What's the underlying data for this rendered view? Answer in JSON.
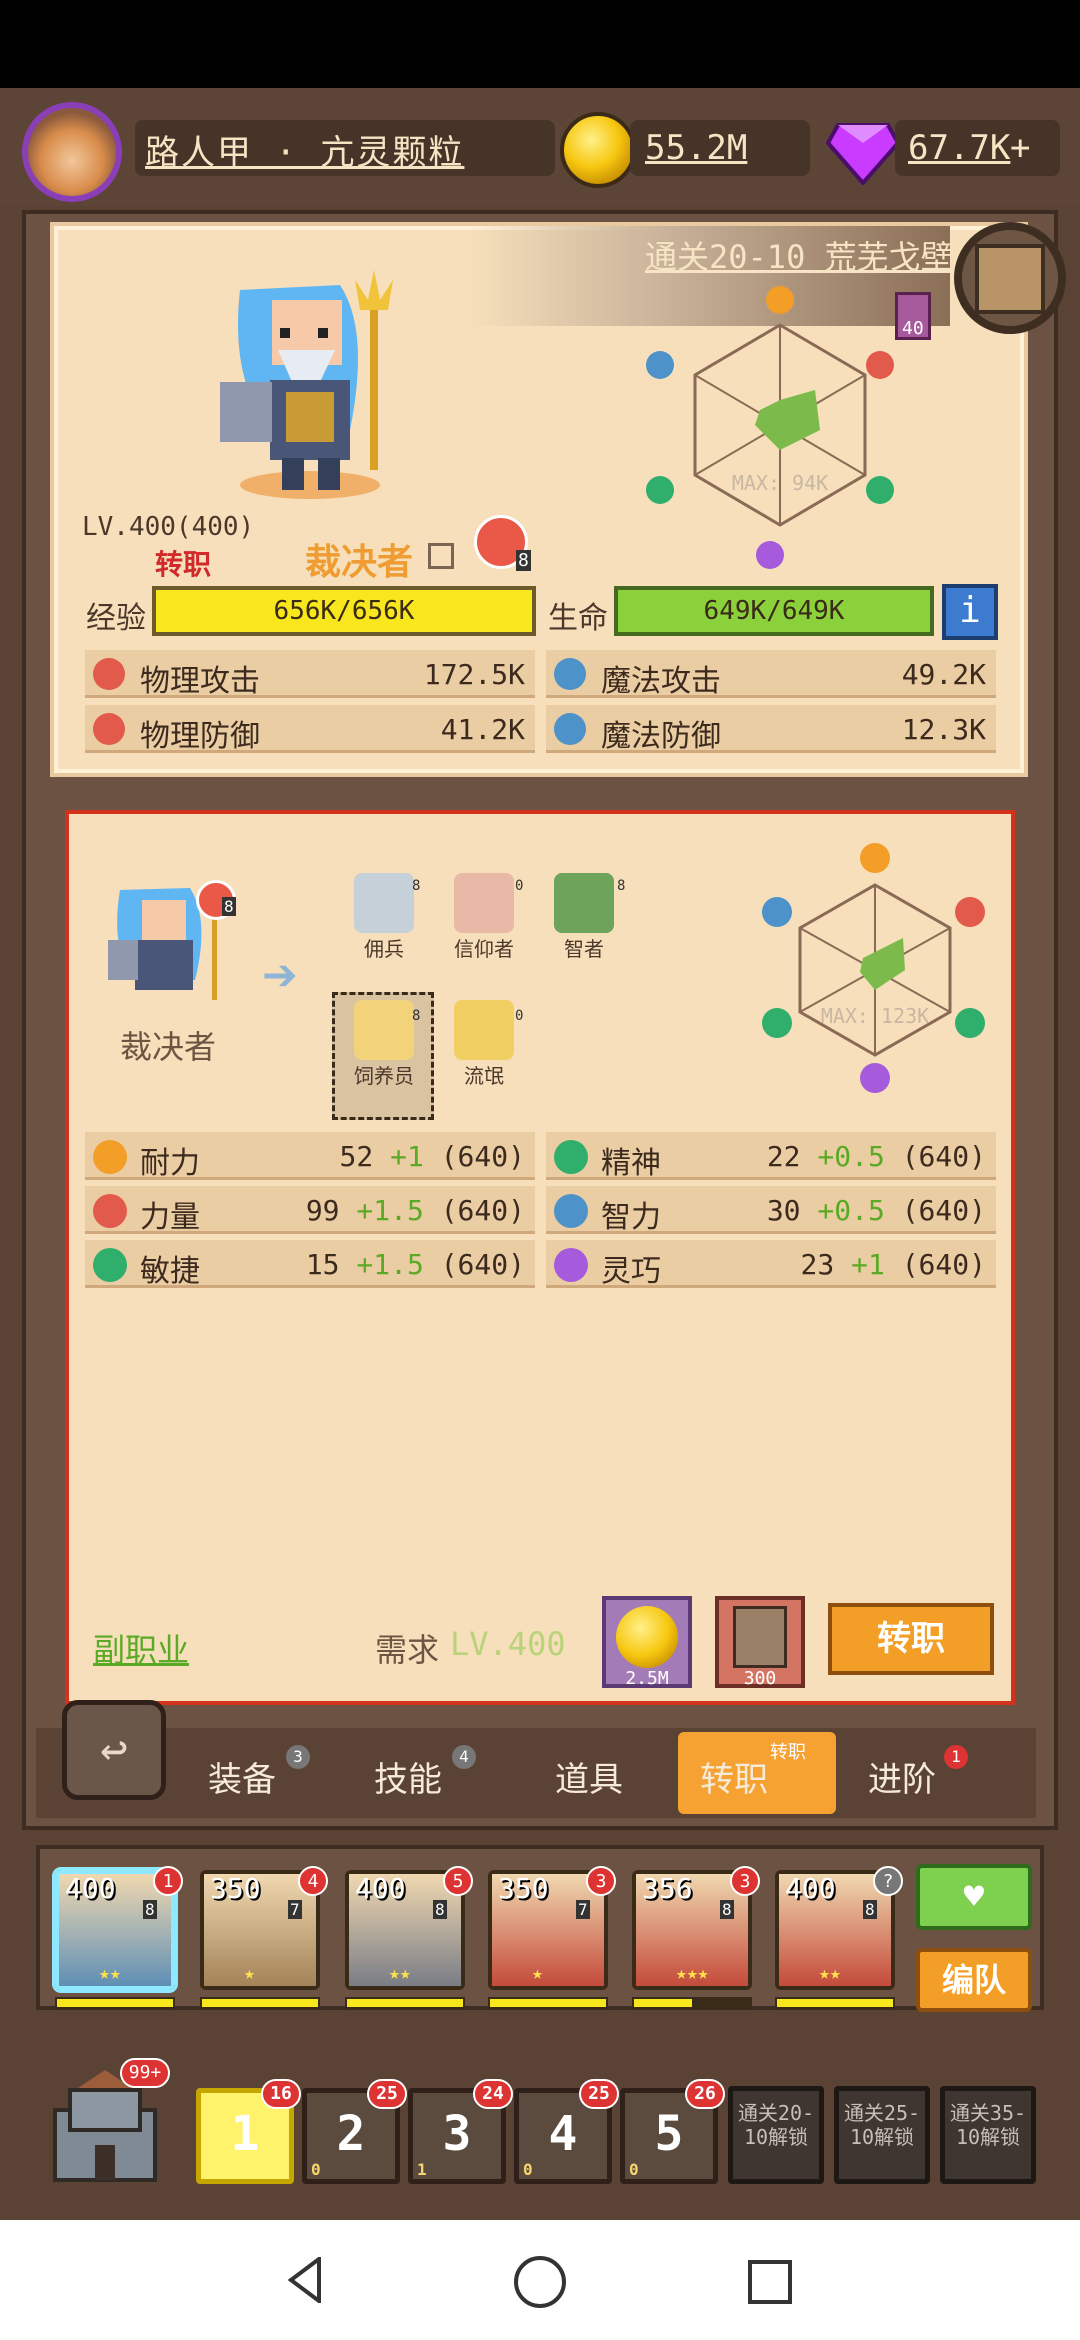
{
  "top": {
    "player_name": "路人甲 · 亢灵颗粒",
    "gold": "55.2M",
    "gems": "67.7K",
    "gem_plus": "+"
  },
  "stage": {
    "label": "通关20-10 荒芜戈壁",
    "scroll_badge": "40"
  },
  "hero": {
    "level_text": "LV.400(400)",
    "transfer_label": "转职",
    "class_name": "裁决者",
    "skill_count": "8",
    "exp_label": "经验",
    "exp_value": "656K/656K",
    "hp_label": "生命",
    "hp_value": "649K/649K",
    "radar_max": "MAX: 94K",
    "stats": [
      {
        "label": "物理攻击",
        "value": "172.5K",
        "icon": "sword-icon",
        "color": "#e25a4b"
      },
      {
        "label": "魔法攻击",
        "value": "49.2K",
        "icon": "magic-staff-icon",
        "color": "#4d93c9"
      },
      {
        "label": "物理防御",
        "value": "41.2K",
        "icon": "armor-icon",
        "color": "#e25a4b"
      },
      {
        "label": "魔法防御",
        "value": "12.3K",
        "icon": "magic-shield-icon",
        "color": "#4d93c9"
      }
    ]
  },
  "job": {
    "current_class": "裁决者",
    "current_badge": "8",
    "options": [
      {
        "name": "佣兵",
        "num": "8"
      },
      {
        "name": "信仰者",
        "num": "0"
      },
      {
        "name": "智者",
        "num": "8"
      },
      {
        "name": "饲养员",
        "num": "8"
      },
      {
        "name": "流氓",
        "num": "0"
      }
    ],
    "radar_max": "MAX: 123K",
    "attributes": [
      {
        "label": "耐力",
        "base": "52",
        "bonus": "+1",
        "cap": "(640)",
        "icon": "stamina-icon",
        "color": "#f39e27"
      },
      {
        "label": "精神",
        "base": "22",
        "bonus": "+0.5",
        "cap": "(640)",
        "icon": "spirit-icon",
        "color": "#2fae6c"
      },
      {
        "label": "力量",
        "base": "99",
        "bonus": "+1.5",
        "cap": "(640)",
        "icon": "strength-icon",
        "color": "#e25a4b"
      },
      {
        "label": "智力",
        "base": "30",
        "bonus": "+0.5",
        "cap": "(640)",
        "icon": "intellect-icon",
        "color": "#4d93c9"
      },
      {
        "label": "敏捷",
        "base": "15",
        "bonus": "+1.5",
        "cap": "(640)",
        "icon": "agility-icon",
        "color": "#2fae6c"
      },
      {
        "label": "灵巧",
        "base": "23",
        "bonus": "+1",
        "cap": "(640)",
        "icon": "dexterity-icon",
        "color": "#a55bdc"
      }
    ],
    "sub_job": "副职业",
    "need_label": "需求",
    "need_level": "LV.400",
    "cost_gold": "2.5M",
    "cost_scroll": "300",
    "button": "转职"
  },
  "tabs": [
    {
      "label": "装备",
      "badge": "3"
    },
    {
      "label": "技能",
      "badge": "4"
    },
    {
      "label": "道具",
      "badge": ""
    },
    {
      "label": "转职",
      "badge": "转职"
    },
    {
      "label": "进阶",
      "badge": "1"
    }
  ],
  "team": {
    "heroes": [
      {
        "level": "400",
        "sub": "8",
        "badge": "1",
        "stars": "★★",
        "color": "#5f8fb5",
        "bar": 1.0
      },
      {
        "level": "350",
        "sub": "7",
        "badge": "4",
        "stars": "★",
        "color": "#a48358",
        "bar": 1.0
      },
      {
        "level": "400",
        "sub": "8",
        "badge": "5",
        "stars": "★★",
        "color": "#7a7d86",
        "bar": 1.0
      },
      {
        "level": "350",
        "sub": "7",
        "badge": "3",
        "stars": "★",
        "color": "#c44b3b",
        "bar": 1.0
      },
      {
        "level": "356",
        "sub": "8",
        "badge": "3",
        "stars": "★★★",
        "color": "#c44b3b",
        "bar": 0.5
      },
      {
        "level": "400",
        "sub": "8",
        "badge": "?",
        "stars": "★★",
        "color": "#c44b3b",
        "bar": 1.0
      }
    ],
    "team_button": "编队"
  },
  "levels": {
    "castle_badge": "99+",
    "slots": [
      {
        "num": "1",
        "badge": "16",
        "small": ""
      },
      {
        "num": "2",
        "badge": "25",
        "small": "0"
      },
      {
        "num": "3",
        "badge": "24",
        "small": "1"
      },
      {
        "num": "4",
        "badge": "25",
        "small": "0"
      },
      {
        "num": "5",
        "badge": "26",
        "small": "0"
      }
    ],
    "locked": [
      "通关20-10解锁",
      "通关25-10解锁",
      "通关35-10解锁"
    ]
  }
}
